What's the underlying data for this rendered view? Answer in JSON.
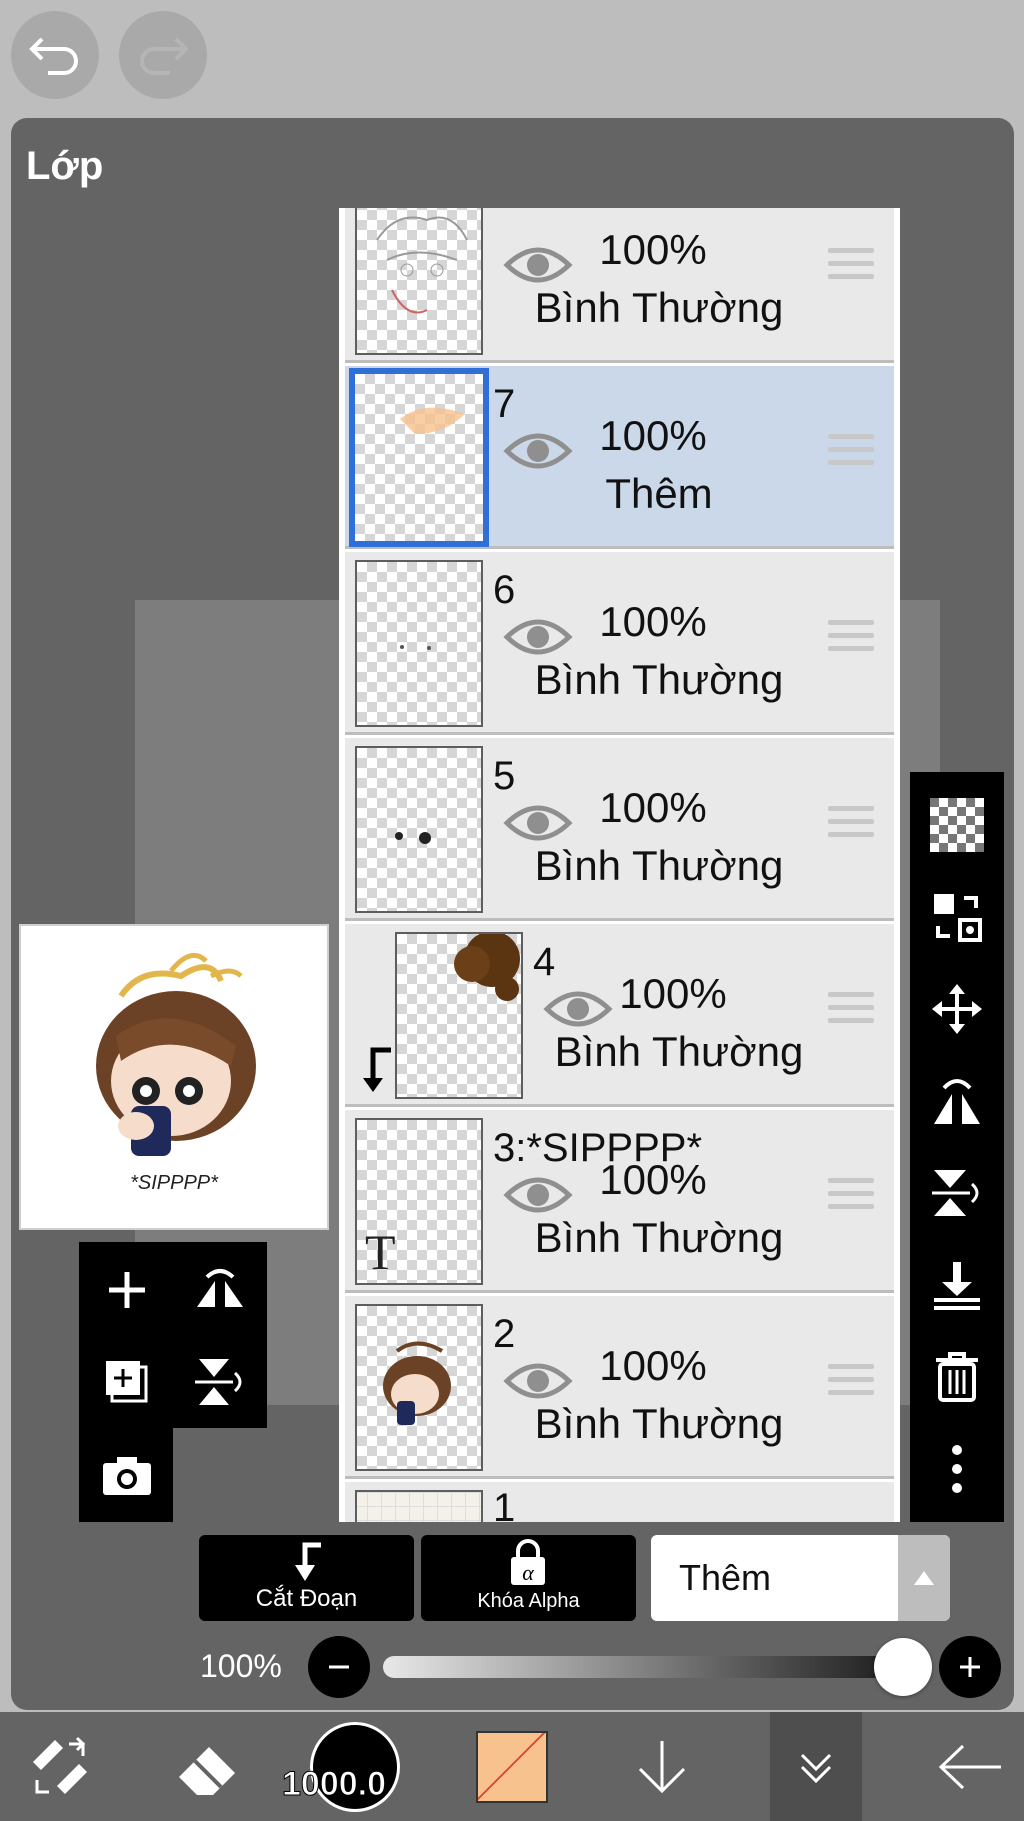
{
  "panel": {
    "title": "Lớp"
  },
  "preview": {
    "caption": "*SIPPPP*"
  },
  "layers": [
    {
      "name": "",
      "opacity": "100%",
      "blend": "Bình Thường"
    },
    {
      "name": "7",
      "opacity": "100%",
      "blend": "Thêm"
    },
    {
      "name": "6",
      "opacity": "100%",
      "blend": "Bình Thường"
    },
    {
      "name": "5",
      "opacity": "100%",
      "blend": "Bình Thường"
    },
    {
      "name": "4",
      "opacity": "100%",
      "blend": "Bình Thường"
    },
    {
      "name": "3:*SIPPPP*",
      "opacity": "100%",
      "blend": "Bình Thường"
    },
    {
      "name": "2",
      "opacity": "100%",
      "blend": "Bình Thường"
    },
    {
      "name": "1",
      "opacity": "",
      "blend": ""
    }
  ],
  "text_layer_icon": "T",
  "actions": {
    "clipping_label": "Cắt Đoạn",
    "alpha_lock_label": "Khóa Alpha",
    "blend_mode_value": "Thêm"
  },
  "opacity_slider": {
    "label": "100%",
    "value": 1.0
  },
  "toolbar": {
    "brush_size": "1000.0",
    "current_color": "#f8c28f"
  },
  "icons": [
    "undo-icon",
    "redo-icon",
    "add-layer-icon",
    "flip-horizontal-icon",
    "add-layer-copy-icon",
    "flip-vertical-icon",
    "camera-icon",
    "checkerboard-icon",
    "transform-icon",
    "move-icon",
    "flip-h-icon",
    "flip-v-icon",
    "merge-down-icon",
    "trash-icon",
    "more-icon",
    "minus-icon",
    "plus-icon",
    "tool-select-icon",
    "eraser-icon",
    "arrow-down-icon",
    "collapse-icon",
    "back-icon"
  ]
}
